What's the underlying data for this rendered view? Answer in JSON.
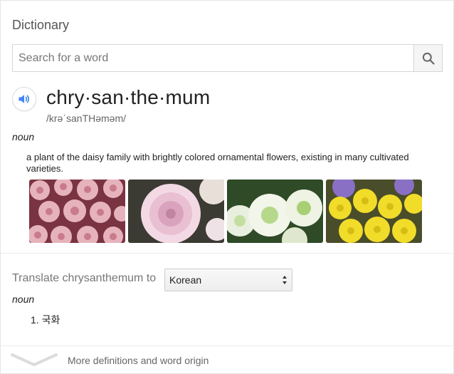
{
  "dictionary": {
    "title": "Dictionary",
    "search": {
      "placeholder": "Search for a word",
      "value": "",
      "button_icon": "search-icon"
    }
  },
  "entry": {
    "audio_icon": "speaker-icon",
    "headword": "chry·san·the·mum",
    "phonetic": "/krəˈsanTHəməm/",
    "part_of_speech": "noun",
    "definition": "a plant of the daisy family with brightly colored ornamental flowers, existing in many cultivated varieties.",
    "images": [
      {
        "subject": "pink-chrysanthemums",
        "colors": {
          "base": "#7a3340",
          "petal": "#e6b3bd",
          "accent": "#c97b8c"
        }
      },
      {
        "subject": "pale-pink-chrysanthemum",
        "colors": {
          "base": "#3b3a33",
          "petal": "#f3d9e4",
          "accent": "#d9a3bd"
        }
      },
      {
        "subject": "green-white-chrysanthemums",
        "colors": {
          "base": "#2f4a26",
          "petal": "#f2f5ea",
          "accent": "#b6d88a"
        }
      },
      {
        "subject": "yellow-chrysanthemums",
        "colors": {
          "base": "#4a4d2a",
          "petal": "#f1dc2a",
          "accent": "#8a70c4"
        }
      }
    ]
  },
  "translate": {
    "label": "Translate chrysanthemum to",
    "language": "Korean",
    "part_of_speech": "noun",
    "items": [
      {
        "number": "1.",
        "text": "국화"
      }
    ]
  },
  "footer": {
    "more_label": "More definitions and word origin",
    "expand_icon": "chevron-down-icon"
  },
  "colors": {
    "accent_blue": "#4285f4",
    "muted_text": "#777777",
    "border": "#d6d6d6"
  }
}
